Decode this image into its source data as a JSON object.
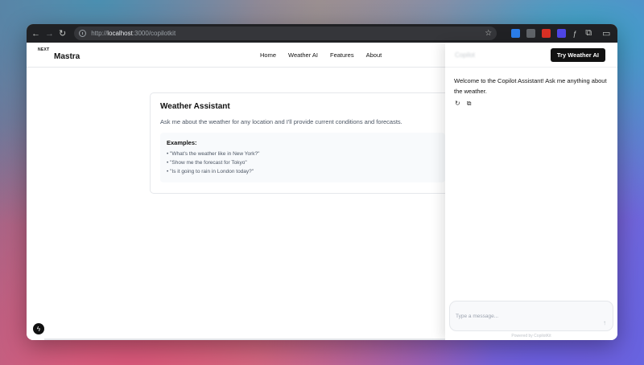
{
  "browser": {
    "url_prefix": "http://",
    "url_host": "localhost",
    "url_rest": ":3000/copilotkit",
    "extension_text": "ƒ"
  },
  "navbar": {
    "logo_small": "NEXT",
    "logo_main": "Mastra",
    "links": [
      "Home",
      "Weather AI",
      "Features",
      "About"
    ],
    "cta": "Try Weather AI"
  },
  "card": {
    "title": "Weather Assistant",
    "description": "Ask me about the weather for any location and I'll provide current conditions and forecasts.",
    "examples_title": "Examples:",
    "examples": [
      "\"What's the weather like in New York?\"",
      "\"Show me the forecast for Tokyo\"",
      "\"Is it going to rain in London today?\""
    ]
  },
  "copilot": {
    "title": "Copilot",
    "welcome": "Welcome to the Copilot Assistant! Ask me anything about the weather.",
    "input_placeholder": "Type a message...",
    "powered_by": "Powered by CopilotKit"
  },
  "colors": {
    "accent": "#111111",
    "chrome_bg": "#202124"
  }
}
